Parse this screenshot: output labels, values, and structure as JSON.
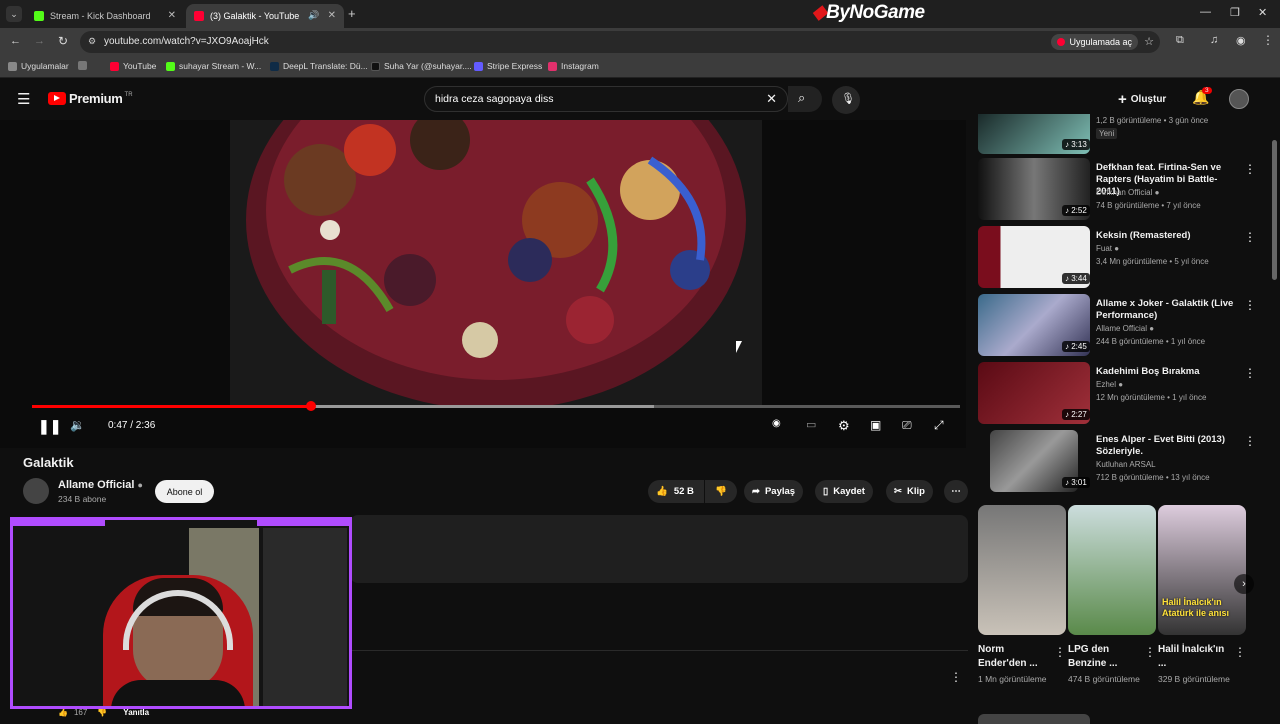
{
  "browser": {
    "tabs": [
      {
        "title": "Stream - Kick Dashboard",
        "color": "#53fc18"
      },
      {
        "title": "(3) Galaktik - YouTube",
        "color": "#ff0033"
      }
    ],
    "brand_overlay": "ByNoGame",
    "url": "youtube.com/watch?v=JXO9AoajHck",
    "open_in_app": "Uygulamada aç",
    "bookmarks": [
      "Uygulamalar",
      "YouTube",
      "suhayar Stream - W...",
      "DeepL Translate: Dü...",
      "Suha Yar (@suhayar....",
      "Stripe Express",
      "Instagram"
    ]
  },
  "youtube": {
    "logo": "Premium",
    "logo_region": "TR",
    "search_query": "hidra ceza sagopaya diss",
    "create_label": "Oluştur",
    "notifications": "3"
  },
  "player": {
    "current_time": "0:47",
    "duration": "2:36",
    "time_display": "0:47 / 2:36",
    "progress_fraction": 0.301,
    "buffered_fraction": 0.67
  },
  "video": {
    "title": "Galaktik",
    "channel": "Allame Official",
    "subscribers": "234 B abone",
    "subscribe_label": "Abone ol",
    "likes": "52 B",
    "share_label": "Paylaş",
    "save_label": "Kaydet",
    "clip_label": "Klip"
  },
  "comment": {
    "likes": "167",
    "reply_label": "Yanıtla"
  },
  "recommendations": [
    {
      "title": "",
      "channel": "",
      "meta": "1,2 B görüntüleme • 3 gün önce",
      "badge": "Yeni",
      "duration": "3:13"
    },
    {
      "title": "Defkhan feat. Firtina-Sen ve Rapters (Hayatim bi Battle-2011)",
      "channel": "Defkhan Official",
      "meta": "74 B görüntüleme • 7 yıl önce",
      "duration": "2:52"
    },
    {
      "title": "Keksin (Remastered)",
      "channel": "Fuat",
      "meta": "3,4 Mn görüntüleme • 5 yıl önce",
      "duration": "3:44"
    },
    {
      "title": "Allame x Joker - Galaktik (Live Performance)",
      "channel": "Allame Official",
      "meta": "244 B görüntüleme • 1 yıl önce",
      "duration": "2:45"
    },
    {
      "title": "Kadehimi Boş Bırakma",
      "channel": "Ezhel",
      "meta": "12 Mn görüntüleme • 1 yıl önce",
      "duration": "2:27"
    },
    {
      "title": "Enes Alper - Evet Bitti (2013) Sözleriyle.",
      "channel": "Kutluhan ARSAL",
      "meta": "712 B görüntüleme • 13 yıl önce",
      "duration": "3:01"
    }
  ],
  "shorts": [
    {
      "title": "Norm Ender'den ...",
      "views": "1 Mn görüntüleme"
    },
    {
      "title": "LPG den Benzine ...",
      "views": "474 B görüntüleme"
    },
    {
      "title": "Halil İnalcık'ın ...",
      "views": "329 B görüntüleme",
      "overlay": "Halil İnalcık'ın Atatürk ile anısı"
    }
  ],
  "colors": {
    "accent": "#ff0000",
    "webcam_frame": "#b04cff"
  }
}
